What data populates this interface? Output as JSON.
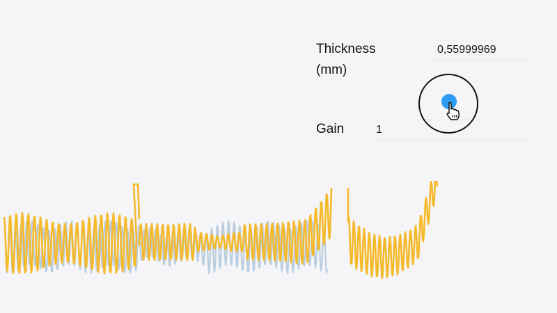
{
  "params": {
    "thickness": {
      "label": "Thickness (mm)",
      "value": "0,55999969"
    },
    "gain": {
      "label": "Gain",
      "value": "1"
    }
  },
  "icons": {
    "cursor": "pointer-hand-icon",
    "slider": "slider-knob"
  },
  "colors": {
    "processed_signal": "#f5b92a",
    "reference_signal": "#b8cde0",
    "slider_knob": "#2f9bf5"
  }
}
